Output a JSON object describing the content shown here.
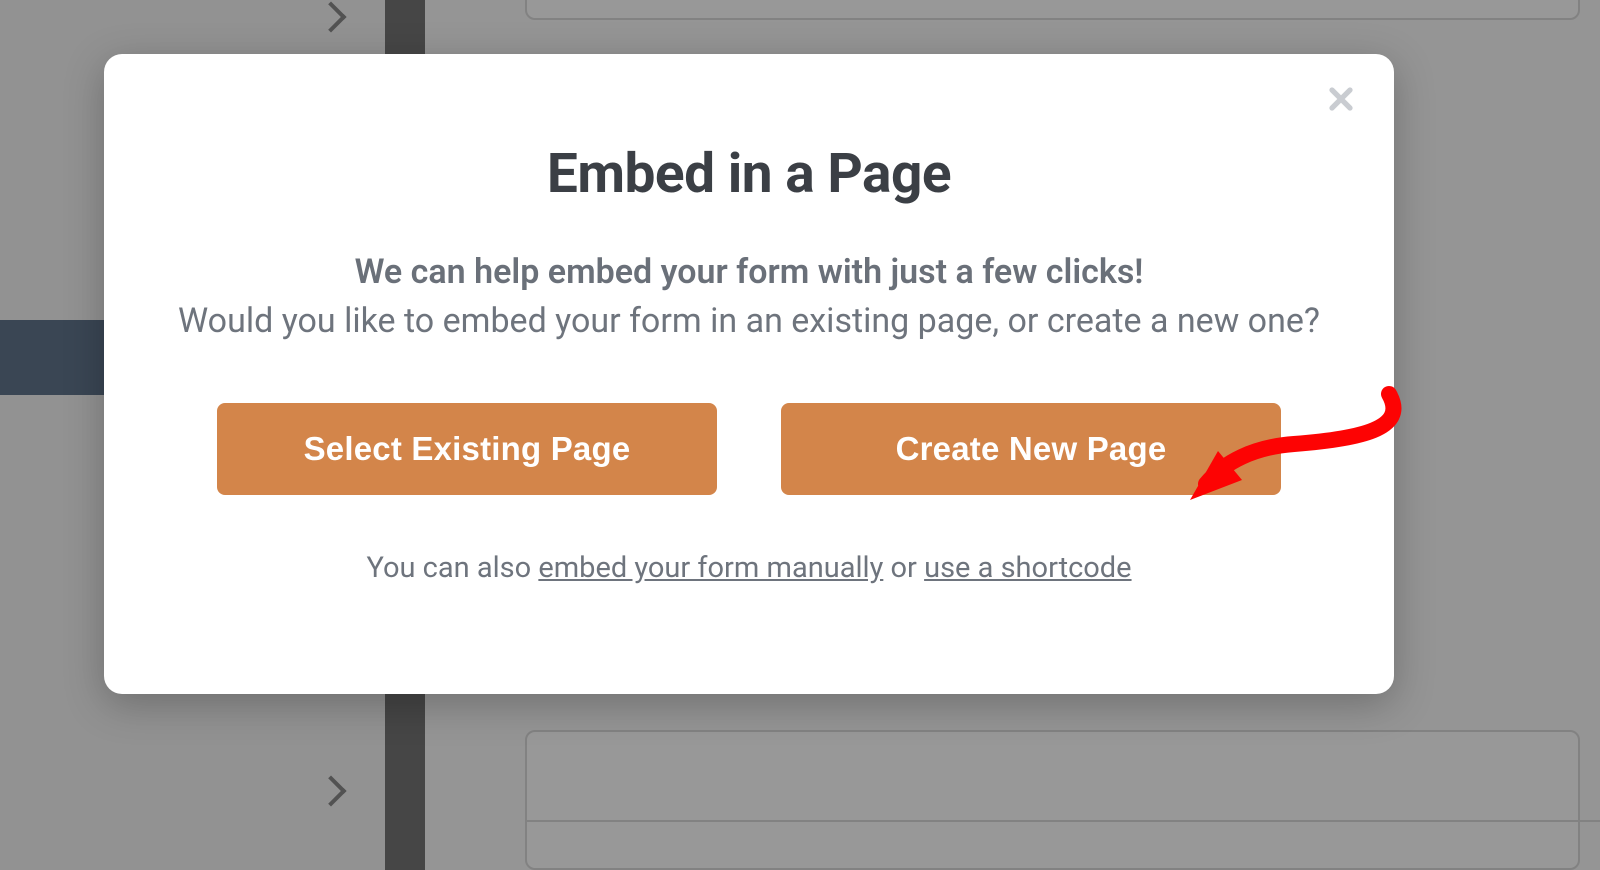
{
  "modal": {
    "title": "Embed in a Page",
    "lead_strong": "We can help embed your form with just a few clicks!",
    "lead_question": "Would you like to embed your form in an existing page, or create a new one?",
    "buttons": {
      "select_existing": "Select Existing Page",
      "create_new": "Create New Page"
    },
    "footer": {
      "prefix": "You can also ",
      "link_manual": "embed your form manually",
      "mid": " or ",
      "link_shortcode": "use a shortcode"
    }
  },
  "annotation": {
    "target": "create-new-page-button",
    "color": "#fd0303"
  }
}
